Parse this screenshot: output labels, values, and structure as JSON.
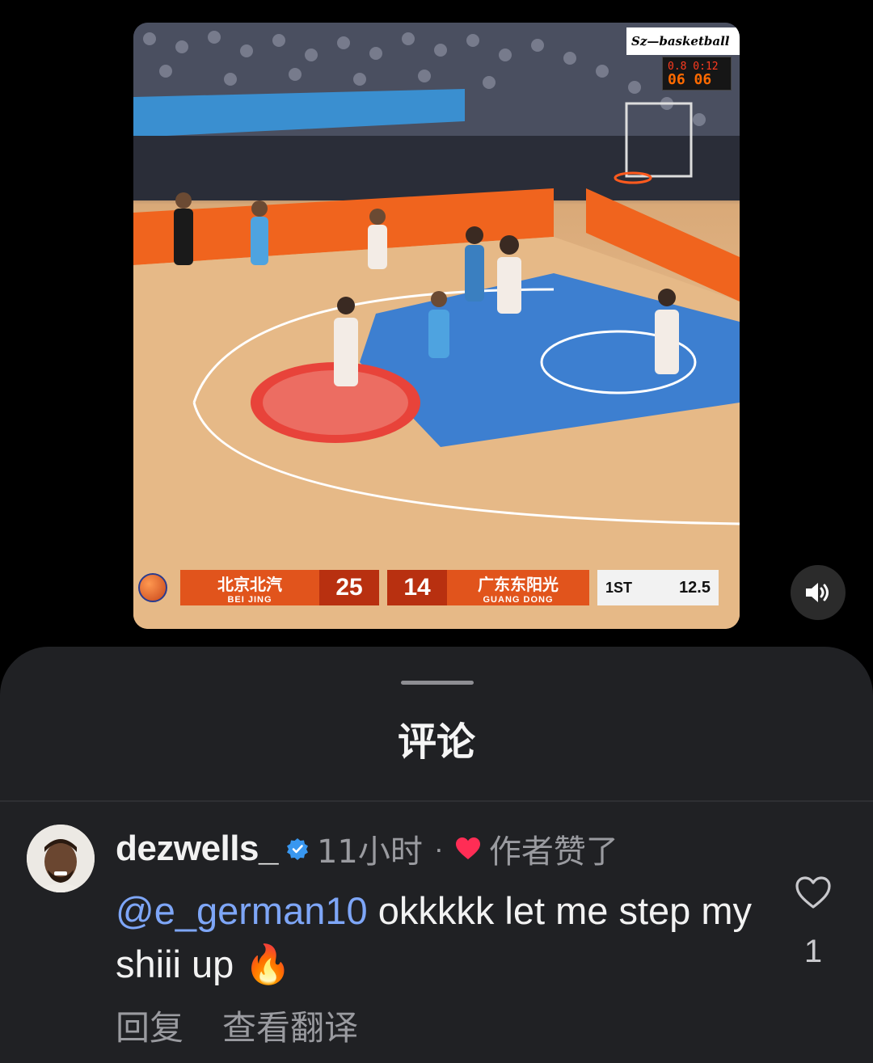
{
  "video": {
    "watermark": "Sz—basketball",
    "shot_clock": {
      "top": "0.8 0:12",
      "bottom": "06 06"
    },
    "scoreboard": {
      "home_name_cn": "北京北汽",
      "home_name_en": "BEI JING",
      "home_score": "25",
      "away_score": "14",
      "away_name_cn": "广东东阳光",
      "away_name_en": "GUANG DONG",
      "period": "1ST",
      "clock": "12.5"
    },
    "sound_icon": "speaker-on-icon"
  },
  "sheet": {
    "title": "评论"
  },
  "comment": {
    "username": "dezwells_",
    "time": "11小时",
    "separator": "·",
    "author_liked": "作者赞了",
    "mention": "@e_german10",
    "text": " okkkkk let me step my shiii up ",
    "emoji": "🔥",
    "reply_label": "回复",
    "translate_label": "查看翻译",
    "like_count": "1"
  },
  "colors": {
    "background": "#000000",
    "sheet": "#202124",
    "mention": "#7ea6f7",
    "muted": "#9a9ba0",
    "heart": "#ff2d55",
    "verified": "#3897f0"
  }
}
